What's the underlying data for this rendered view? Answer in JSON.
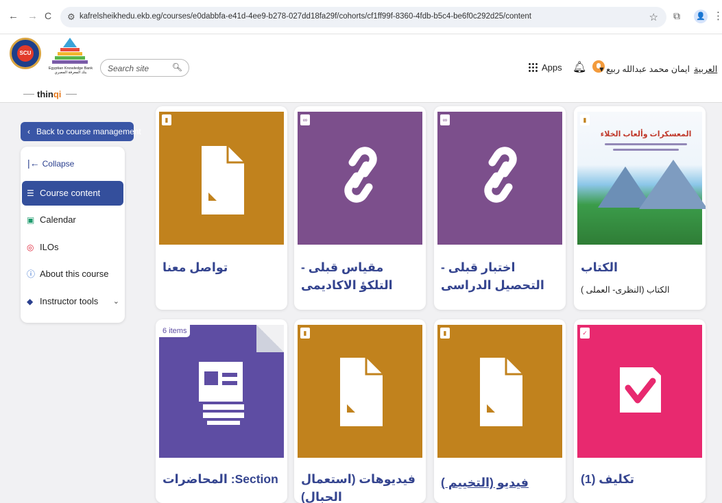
{
  "browser": {
    "url": "kafrelsheikhedu.ekb.eg/courses/e0dabbfa-e41d-4ee9-b278-027dd18fa29f/cohorts/cf1ff99f-8360-4fdb-b5c4-be6f0c292d25/content",
    "back_icon": "←",
    "forward_icon": "→",
    "reload_icon": "C",
    "profile_icon": "👤"
  },
  "header": {
    "ekb_caption_en": "Egyptian Knowledge Bank",
    "ekb_caption_ar": "بنك المعرفة المصري",
    "scu_text": "SCU",
    "thinqi_prefix": "thin",
    "thinqi_accent": "qi",
    "search_placeholder": "Search site",
    "apps_label": "Apps",
    "username": "ايمان محمد عبدالله ربيع",
    "language": "العربية"
  },
  "sidebar": {
    "back_label": "Back to course management",
    "collapse_label": "Collapse",
    "items": [
      {
        "label": "Course content",
        "icon": "document-list-icon",
        "active": true
      },
      {
        "label": "Calendar",
        "icon": "calendar-icon",
        "active": false
      },
      {
        "label": "ILOs",
        "icon": "target-icon",
        "active": false
      },
      {
        "label": "About this course",
        "icon": "info-icon",
        "active": false
      },
      {
        "label": "Instructor tools",
        "icon": "graduation-cap-icon",
        "active": false
      }
    ]
  },
  "cards": [
    {
      "title": "الكتاب",
      "subtitle": "الكتاب (النظرى- العملى )",
      "type_icon": "file-icon",
      "thumb": "book-cover",
      "book_title": "المعسكرات وألعاب الخلاء"
    },
    {
      "title": "اختبار قبلى - التحصيل الدراسى",
      "type_icon": "link-icon",
      "thumb": "link"
    },
    {
      "title": "مقياس قبلى - التلكؤ الاكاديمى",
      "type_icon": "link-icon",
      "thumb": "link"
    },
    {
      "title": "تواصل معنا",
      "type_icon": "file-icon",
      "thumb": "document"
    },
    {
      "title": "تكليف (1)",
      "type_icon": "assignment-icon",
      "thumb": "assignment"
    },
    {
      "title": "فيديو (التخييم )",
      "type_icon": "file-icon",
      "thumb": "document"
    },
    {
      "title": "فيديوهات (استعمال الحبال)",
      "type_icon": "file-icon",
      "thumb": "document"
    },
    {
      "title": "Section: المحاضرات",
      "items_label": "6 items",
      "thumb": "section"
    }
  ],
  "colors": {
    "primary": "#344f9c",
    "gold": "#c1821d",
    "purple": "#7c4f8c",
    "indigo": "#5e4da3",
    "pink": "#e8296f"
  }
}
